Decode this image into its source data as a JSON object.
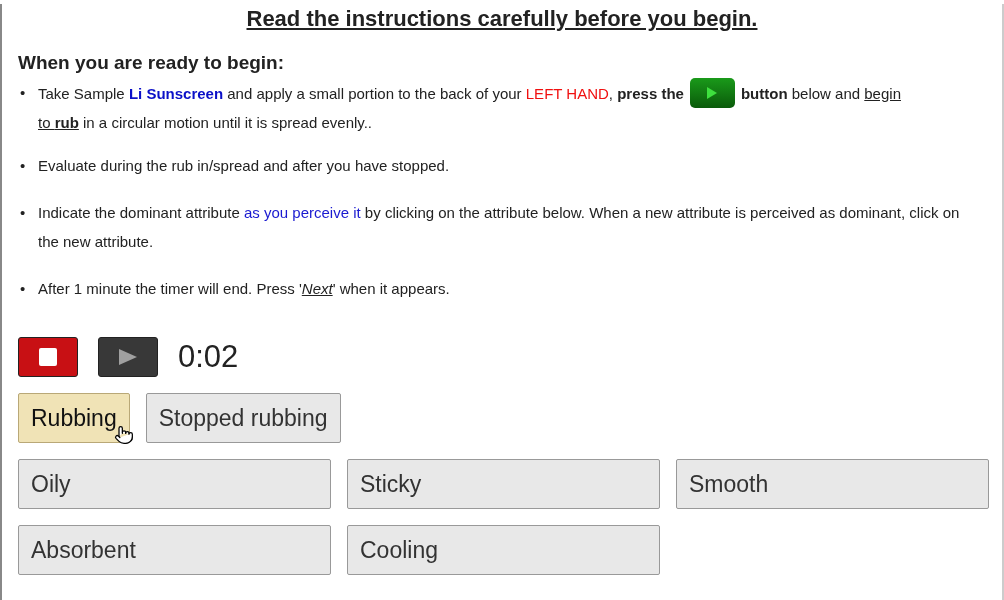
{
  "title": "Read the instructions carefully before you begin.",
  "heading": "When you are ready to begin:",
  "instructions": [
    {
      "marker": "•",
      "parts": [
        {
          "kind": "text",
          "segments": [
            {
              "text": "Take Sample ",
              "kind": "plain"
            },
            {
              "text": "Li Sunscreen",
              "kind": "product"
            },
            {
              "text": " and apply a small portion to the back of your ",
              "kind": "plain"
            },
            {
              "text": "LEFT HAND",
              "kind": "warning"
            },
            {
              "text": ", ",
              "kind": "plain"
            },
            {
              "text": "press the",
              "kind": "strong"
            }
          ]
        },
        {
          "kind": "button"
        },
        {
          "kind": "text",
          "segments": [
            {
              "text": "button",
              "kind": "strong"
            },
            {
              "text": " below and ",
              "kind": "plain"
            },
            {
              "text": "begin",
              "kind": "underlined"
            }
          ]
        },
        {
          "kind": "line",
          "segments": [
            {
              "text": "to ",
              "kind": "underlined"
            },
            {
              "text": "rub",
              "kind": "underlined-strong"
            },
            {
              "text": " in a circular motion until it is spread evenly..",
              "kind": "plain"
            }
          ]
        }
      ]
    },
    {
      "marker": "•",
      "parts": [
        {
          "kind": "text",
          "segments": [
            {
              "text": "Evaluate during the rub in/spread and after you have stopped.",
              "kind": "plain"
            }
          ]
        }
      ]
    },
    {
      "marker": "•",
      "parts": [
        {
          "kind": "text",
          "segments": [
            {
              "text": "Indicate the dominant attribute ",
              "kind": "plain"
            },
            {
              "text": "as you perceive it",
              "kind": "highlight"
            },
            {
              "text": " by clicking on the attribute below. When a new attribute is perceived as dominant, click on the new attribute.",
              "kind": "plain"
            }
          ]
        }
      ]
    },
    {
      "marker": "•",
      "parts": [
        {
          "kind": "text",
          "segments": [
            {
              "text": "After 1 minute the timer will end. Press '",
              "kind": "plain"
            },
            {
              "text": "Next",
              "kind": "underlined-italic"
            },
            {
              "text": "' when it appears.",
              "kind": "plain"
            }
          ]
        }
      ]
    }
  ],
  "timer": "0:02",
  "phases": [
    {
      "label": "Rubbing",
      "selected": true
    },
    {
      "label": "Stopped rubbing",
      "selected": false
    }
  ],
  "attributes": [
    {
      "label": "Oily",
      "selected": false
    },
    {
      "label": "Sticky",
      "selected": false
    },
    {
      "label": "Smooth",
      "selected": false
    },
    {
      "label": "Absorbent",
      "selected": false
    },
    {
      "label": "Cooling",
      "selected": false
    }
  ]
}
